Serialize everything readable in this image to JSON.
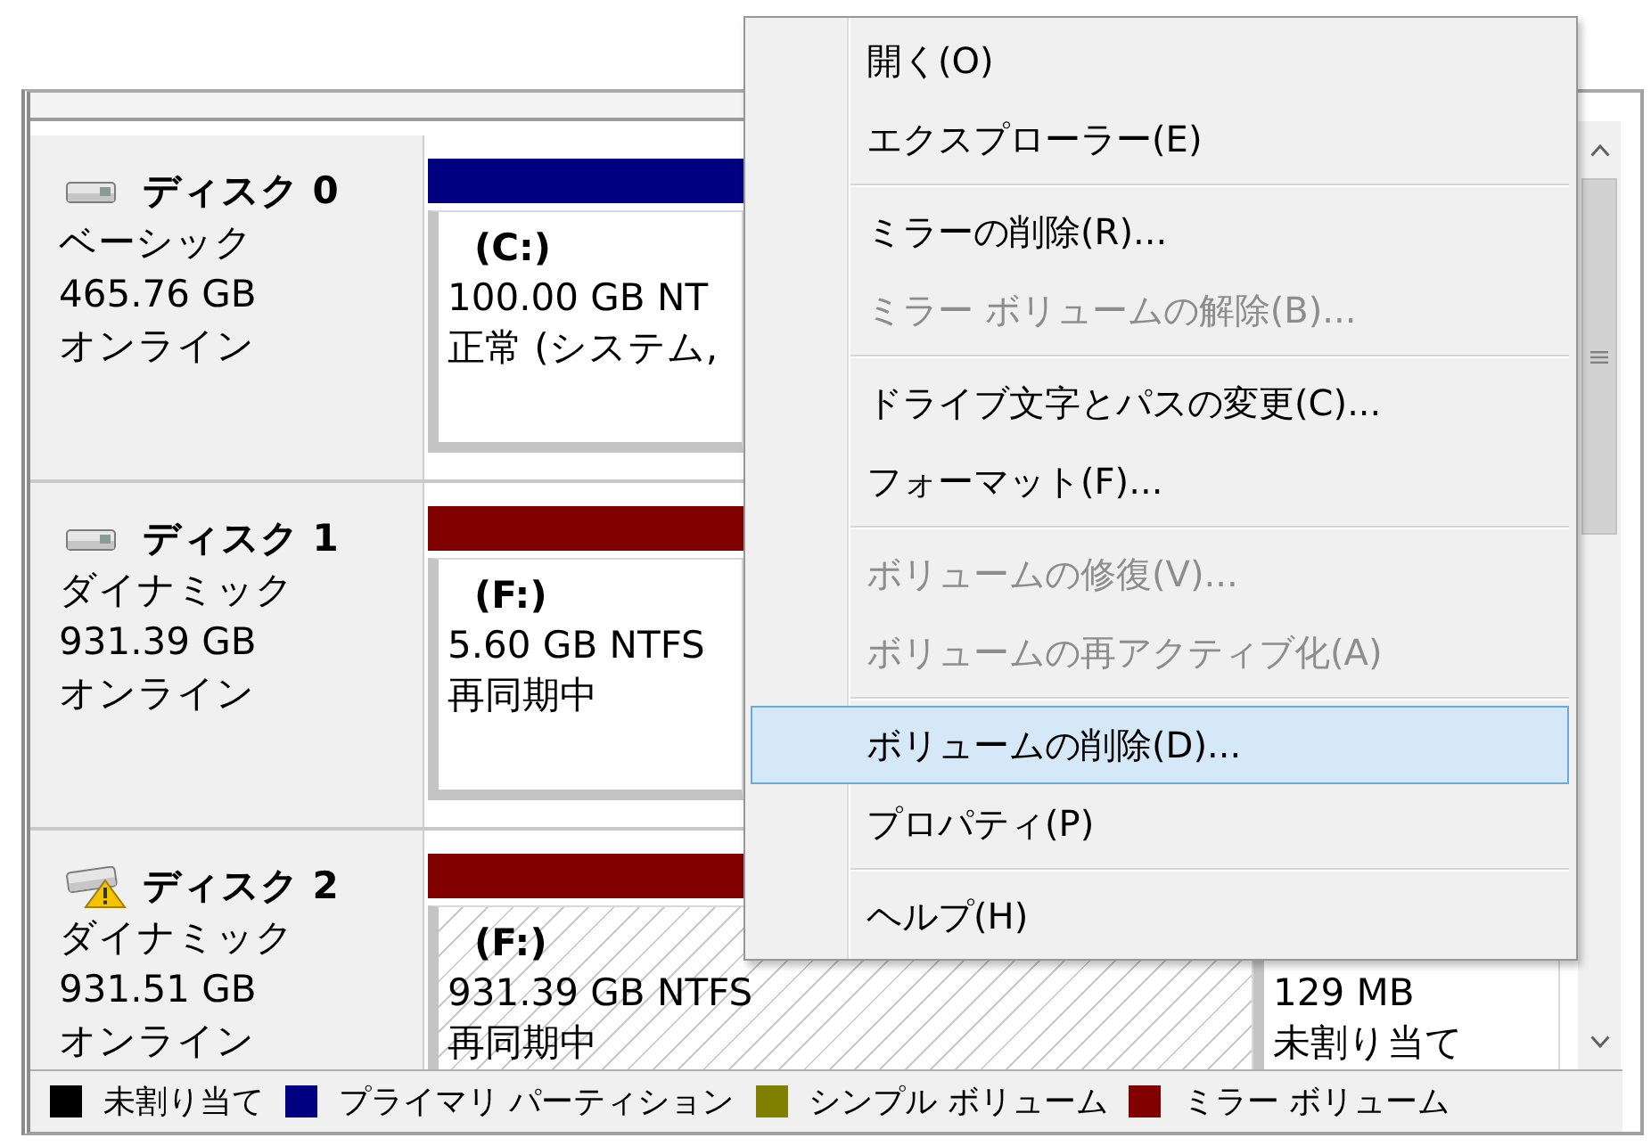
{
  "disks": [
    {
      "name": "ディスク 0",
      "type": "ベーシック",
      "size": "465.76 GB",
      "status": "オンライン",
      "warning": false,
      "partitions": [
        {
          "kind": "primary",
          "label": "(C:)",
          "size": "100.00 GB NT",
          "status": "正常 (システム,",
          "selected": false
        }
      ]
    },
    {
      "name": "ディスク 1",
      "type": "ダイナミック",
      "size": "931.39 GB",
      "status": "オンライン",
      "warning": false,
      "partitions": [
        {
          "kind": "mirror",
          "label": "(F:)",
          "size": "5.60 GB NTFS",
          "status": "再同期中",
          "selected": false
        }
      ]
    },
    {
      "name": "ディスク 2",
      "type": "ダイナミック",
      "size": "931.51 GB",
      "status": "オンライン",
      "warning": true,
      "partitions": [
        {
          "kind": "mirror",
          "label": "(F:)",
          "size": "931.39 GB NTFS",
          "status": "再同期中",
          "selected": true
        },
        {
          "kind": "unallocated",
          "size": "129 MB",
          "status": "未割り当て",
          "selected": false
        }
      ]
    }
  ],
  "legend": [
    {
      "kind": "unallocated",
      "label": "未割り当て",
      "color": "#000000"
    },
    {
      "kind": "primary",
      "label": "プライマリ パーティション",
      "color": "#000080"
    },
    {
      "kind": "simple",
      "label": "シンプル ボリューム",
      "color": "#808000"
    },
    {
      "kind": "mirror",
      "label": "ミラー ボリューム",
      "color": "#800000"
    }
  ],
  "context_menu": {
    "groups": [
      [
        {
          "label": "開く(O)",
          "disabled": false,
          "selected": false
        },
        {
          "label": "エクスプローラー(E)",
          "disabled": false,
          "selected": false
        }
      ],
      [
        {
          "label": "ミラーの削除(R)...",
          "disabled": false,
          "selected": false
        },
        {
          "label": "ミラー ボリュームの解除(B)...",
          "disabled": true,
          "selected": false
        }
      ],
      [
        {
          "label": "ドライブ文字とパスの変更(C)...",
          "disabled": false,
          "selected": false
        },
        {
          "label": "フォーマット(F)...",
          "disabled": false,
          "selected": false
        }
      ],
      [
        {
          "label": "ボリュームの修復(V)...",
          "disabled": true,
          "selected": false
        },
        {
          "label": "ボリュームの再アクティブ化(A)",
          "disabled": true,
          "selected": false
        }
      ],
      [
        {
          "label": "ボリュームの削除(D)...",
          "disabled": false,
          "selected": true
        },
        {
          "label": "プロパティ(P)",
          "disabled": false,
          "selected": false
        }
      ],
      [
        {
          "label": "ヘルプ(H)",
          "disabled": false,
          "selected": false
        }
      ]
    ]
  }
}
